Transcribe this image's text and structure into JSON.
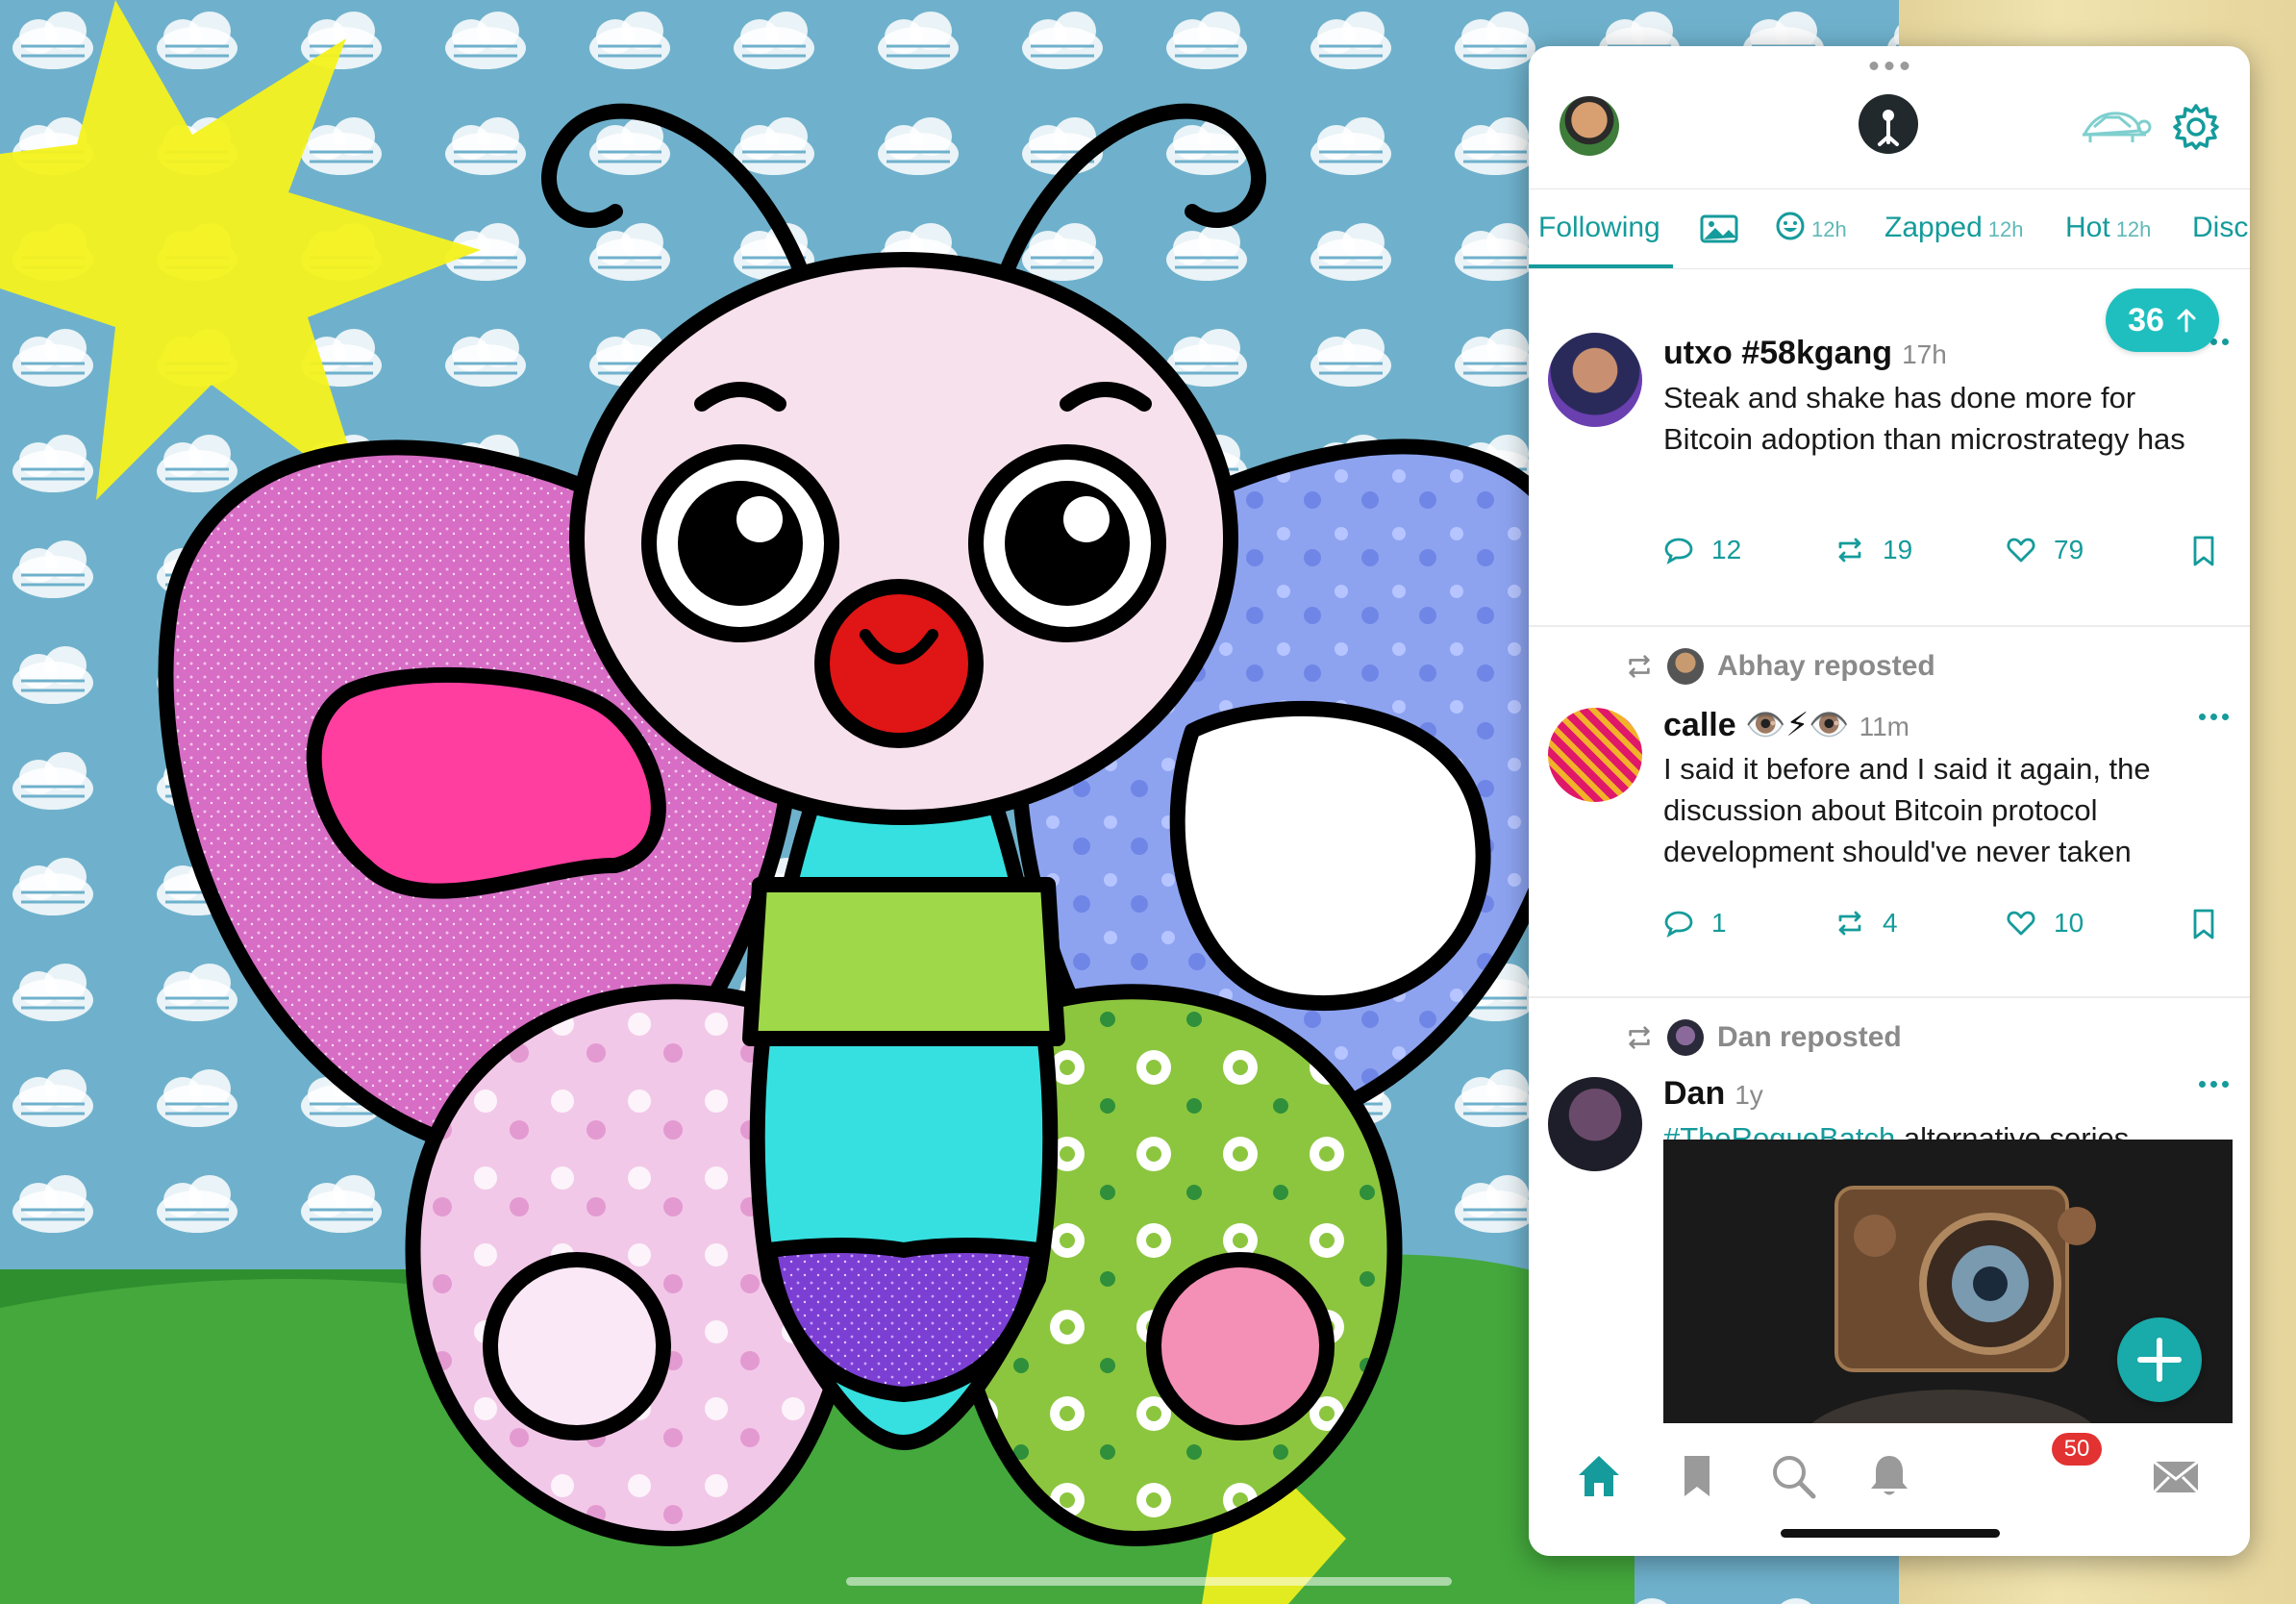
{
  "tabs": {
    "following": "Following",
    "reactions_age": "12h",
    "zapped": "Zapped",
    "zapped_age": "12h",
    "hot": "Hot",
    "hot_age": "12h",
    "discover": "Disc"
  },
  "new_posts_count": "36",
  "posts": [
    {
      "author": "utxo #58kgang",
      "time": "17h",
      "content": "Steak and shake has done more for Bitcoin adoption than microstrategy has",
      "replies": "12",
      "reposts": "19",
      "likes": "79"
    },
    {
      "reposted_by": "Abhay reposted",
      "author": "calle 👁️⚡👁️",
      "time": "11m",
      "content": "I said it before and I said it again, the discussion about Bitcoin protocol development should've never taken",
      "replies": "1",
      "reposts": "4",
      "likes": "10"
    },
    {
      "reposted_by": "Dan reposted",
      "author": "Dan",
      "time": "1y",
      "hashtag": "#TheRogueBatch",
      "content_rest": " alternative series"
    }
  ],
  "notifications_badge": "50",
  "colors": {
    "accent": "#159b9b",
    "pill": "#1fbfbf",
    "badge": "#e33232"
  },
  "icons": [
    "avatar",
    "relay-logo",
    "turtle-icon",
    "gear-icon",
    "image-icon",
    "smiley-icon",
    "reply-icon",
    "repost-icon",
    "heart-icon",
    "bookmark-icon",
    "home-icon",
    "search-icon",
    "bell-icon",
    "mail-icon",
    "plus-icon"
  ]
}
